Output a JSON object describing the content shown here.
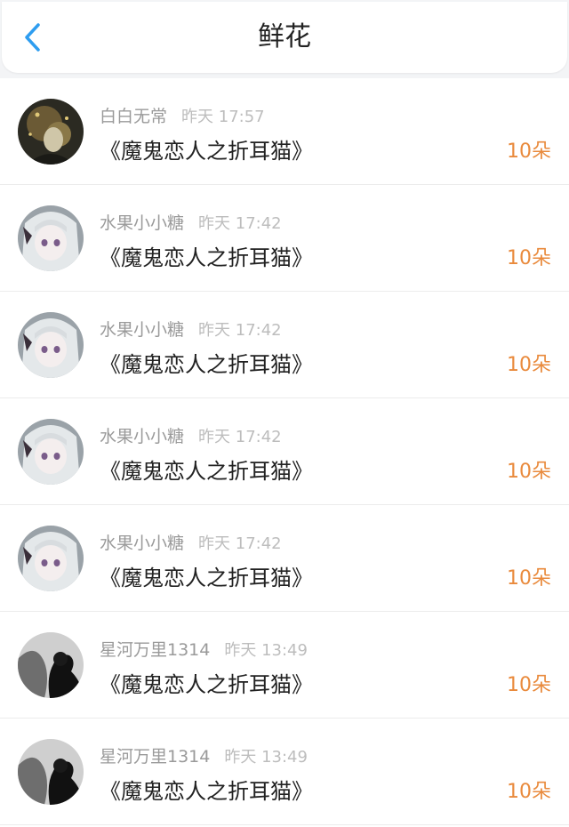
{
  "header": {
    "title": "鲜花",
    "back_icon": "chevron-left-icon",
    "accent": "#2e9df0"
  },
  "gifts": [
    {
      "user": "白白无常",
      "time": "昨天 17:57",
      "work": "《魔鬼恋人之折耳猫》",
      "amount": "10朵",
      "avatar": "dark-art"
    },
    {
      "user": "水果小小糖",
      "time": "昨天 17:42",
      "work": "《魔鬼恋人之折耳猫》",
      "amount": "10朵",
      "avatar": "anime-girl"
    },
    {
      "user": "水果小小糖",
      "time": "昨天 17:42",
      "work": "《魔鬼恋人之折耳猫》",
      "amount": "10朵",
      "avatar": "anime-girl"
    },
    {
      "user": "水果小小糖",
      "time": "昨天 17:42",
      "work": "《魔鬼恋人之折耳猫》",
      "amount": "10朵",
      "avatar": "anime-girl"
    },
    {
      "user": "水果小小糖",
      "time": "昨天 17:42",
      "work": "《魔鬼恋人之折耳猫》",
      "amount": "10朵",
      "avatar": "anime-girl"
    },
    {
      "user": "星河万里1314",
      "time": "昨天 13:49",
      "work": "《魔鬼恋人之折耳猫》",
      "amount": "10朵",
      "avatar": "couple-silhouette"
    },
    {
      "user": "星河万里1314",
      "time": "昨天 13:49",
      "work": "《魔鬼恋人之折耳猫》",
      "amount": "10朵",
      "avatar": "couple-silhouette"
    }
  ],
  "colors": {
    "amount": "#e98a3c",
    "username": "#9a9a9a",
    "time": "#bdbdbd"
  }
}
